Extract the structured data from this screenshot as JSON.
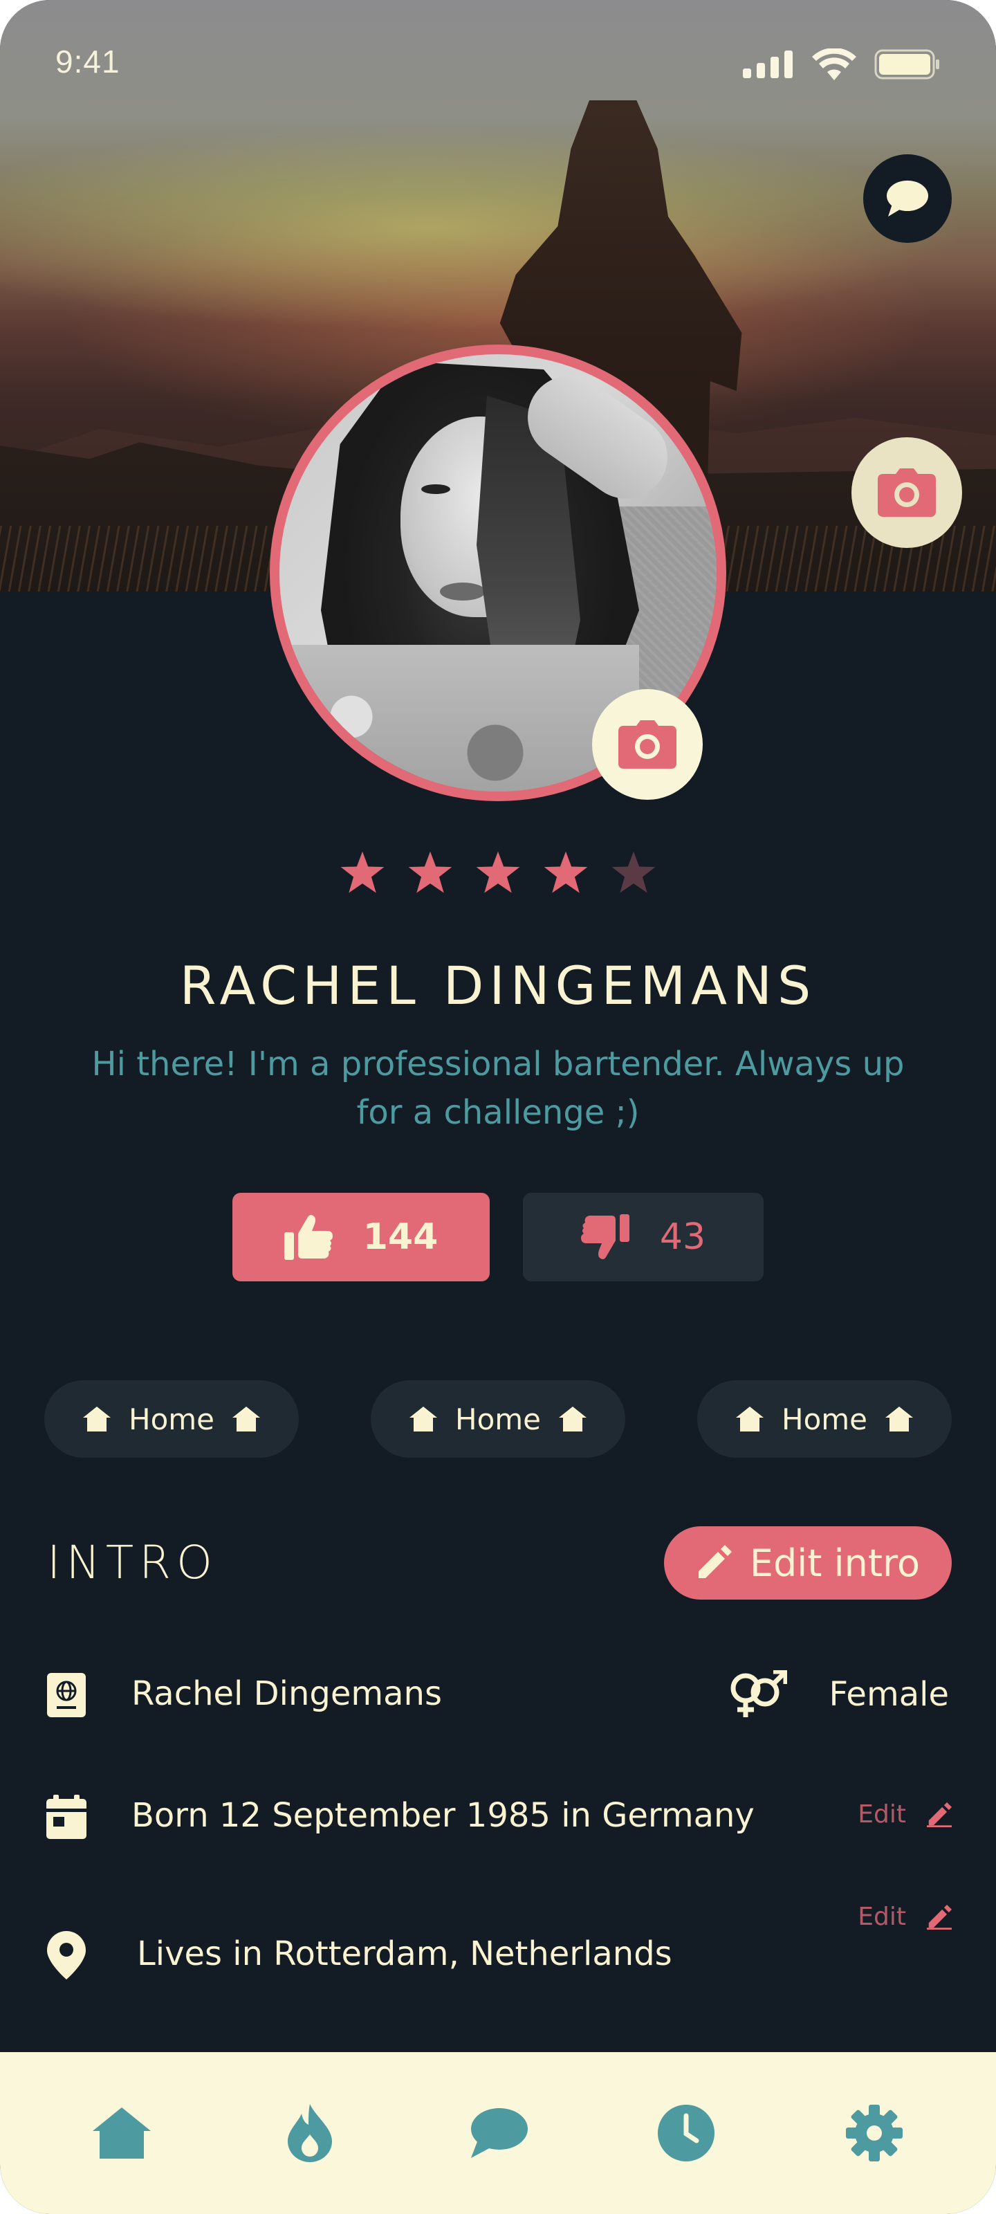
{
  "status_bar": {
    "time": "9:41"
  },
  "profile": {
    "name": "RACHEL DINGEMANS",
    "bio": "Hi there! I'm a professional bartender. Always up for a challenge ;)",
    "rating": 4,
    "rating_max": 5
  },
  "votes": {
    "likes": "144",
    "dislikes": "43"
  },
  "chips": [
    {
      "label": "Home",
      "icon": "home-icon"
    },
    {
      "label": "Home",
      "icon": "home-icon"
    },
    {
      "label": "Home",
      "icon": "home-icon"
    }
  ],
  "intro": {
    "title": "INTRO",
    "edit_label": "Edit intro",
    "full_name": "Rachel Dingemans",
    "gender": "Female",
    "born": "Born 12 September 1985 in Germany",
    "lives": "Lives in Rotterdam, Netherlands",
    "row_edit_label": "Edit"
  },
  "nav": {
    "items": [
      "home-icon",
      "fire-icon",
      "chat-icon",
      "clock-icon",
      "settings-icon"
    ]
  },
  "colors": {
    "background": "#131c24",
    "accent": "#e26a76",
    "cream": "#f9f3d2",
    "teal": "#4d9aa0",
    "nav_bg": "#faf7da"
  }
}
